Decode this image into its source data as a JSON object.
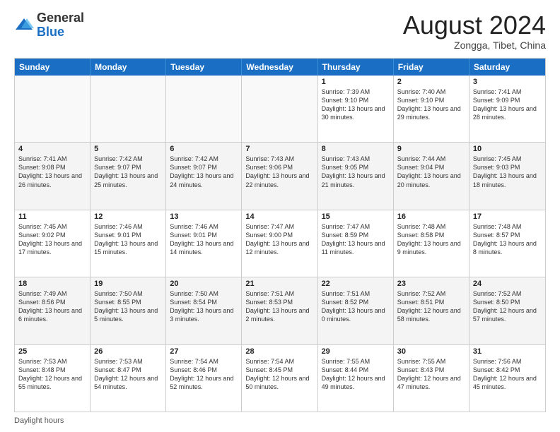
{
  "logo": {
    "general": "General",
    "blue": "Blue"
  },
  "title": {
    "month_year": "August 2024",
    "location": "Zongga, Tibet, China"
  },
  "header_days": [
    "Sunday",
    "Monday",
    "Tuesday",
    "Wednesday",
    "Thursday",
    "Friday",
    "Saturday"
  ],
  "weeks": [
    [
      {
        "day": "",
        "info": ""
      },
      {
        "day": "",
        "info": ""
      },
      {
        "day": "",
        "info": ""
      },
      {
        "day": "",
        "info": ""
      },
      {
        "day": "1",
        "info": "Sunrise: 7:39 AM\nSunset: 9:10 PM\nDaylight: 13 hours and 30 minutes."
      },
      {
        "day": "2",
        "info": "Sunrise: 7:40 AM\nSunset: 9:10 PM\nDaylight: 13 hours and 29 minutes."
      },
      {
        "day": "3",
        "info": "Sunrise: 7:41 AM\nSunset: 9:09 PM\nDaylight: 13 hours and 28 minutes."
      }
    ],
    [
      {
        "day": "4",
        "info": "Sunrise: 7:41 AM\nSunset: 9:08 PM\nDaylight: 13 hours and 26 minutes."
      },
      {
        "day": "5",
        "info": "Sunrise: 7:42 AM\nSunset: 9:07 PM\nDaylight: 13 hours and 25 minutes."
      },
      {
        "day": "6",
        "info": "Sunrise: 7:42 AM\nSunset: 9:07 PM\nDaylight: 13 hours and 24 minutes."
      },
      {
        "day": "7",
        "info": "Sunrise: 7:43 AM\nSunset: 9:06 PM\nDaylight: 13 hours and 22 minutes."
      },
      {
        "day": "8",
        "info": "Sunrise: 7:43 AM\nSunset: 9:05 PM\nDaylight: 13 hours and 21 minutes."
      },
      {
        "day": "9",
        "info": "Sunrise: 7:44 AM\nSunset: 9:04 PM\nDaylight: 13 hours and 20 minutes."
      },
      {
        "day": "10",
        "info": "Sunrise: 7:45 AM\nSunset: 9:03 PM\nDaylight: 13 hours and 18 minutes."
      }
    ],
    [
      {
        "day": "11",
        "info": "Sunrise: 7:45 AM\nSunset: 9:02 PM\nDaylight: 13 hours and 17 minutes."
      },
      {
        "day": "12",
        "info": "Sunrise: 7:46 AM\nSunset: 9:01 PM\nDaylight: 13 hours and 15 minutes."
      },
      {
        "day": "13",
        "info": "Sunrise: 7:46 AM\nSunset: 9:01 PM\nDaylight: 13 hours and 14 minutes."
      },
      {
        "day": "14",
        "info": "Sunrise: 7:47 AM\nSunset: 9:00 PM\nDaylight: 13 hours and 12 minutes."
      },
      {
        "day": "15",
        "info": "Sunrise: 7:47 AM\nSunset: 8:59 PM\nDaylight: 13 hours and 11 minutes."
      },
      {
        "day": "16",
        "info": "Sunrise: 7:48 AM\nSunset: 8:58 PM\nDaylight: 13 hours and 9 minutes."
      },
      {
        "day": "17",
        "info": "Sunrise: 7:48 AM\nSunset: 8:57 PM\nDaylight: 13 hours and 8 minutes."
      }
    ],
    [
      {
        "day": "18",
        "info": "Sunrise: 7:49 AM\nSunset: 8:56 PM\nDaylight: 13 hours and 6 minutes."
      },
      {
        "day": "19",
        "info": "Sunrise: 7:50 AM\nSunset: 8:55 PM\nDaylight: 13 hours and 5 minutes."
      },
      {
        "day": "20",
        "info": "Sunrise: 7:50 AM\nSunset: 8:54 PM\nDaylight: 13 hours and 3 minutes."
      },
      {
        "day": "21",
        "info": "Sunrise: 7:51 AM\nSunset: 8:53 PM\nDaylight: 13 hours and 2 minutes."
      },
      {
        "day": "22",
        "info": "Sunrise: 7:51 AM\nSunset: 8:52 PM\nDaylight: 13 hours and 0 minutes."
      },
      {
        "day": "23",
        "info": "Sunrise: 7:52 AM\nSunset: 8:51 PM\nDaylight: 12 hours and 58 minutes."
      },
      {
        "day": "24",
        "info": "Sunrise: 7:52 AM\nSunset: 8:50 PM\nDaylight: 12 hours and 57 minutes."
      }
    ],
    [
      {
        "day": "25",
        "info": "Sunrise: 7:53 AM\nSunset: 8:48 PM\nDaylight: 12 hours and 55 minutes."
      },
      {
        "day": "26",
        "info": "Sunrise: 7:53 AM\nSunset: 8:47 PM\nDaylight: 12 hours and 54 minutes."
      },
      {
        "day": "27",
        "info": "Sunrise: 7:54 AM\nSunset: 8:46 PM\nDaylight: 12 hours and 52 minutes."
      },
      {
        "day": "28",
        "info": "Sunrise: 7:54 AM\nSunset: 8:45 PM\nDaylight: 12 hours and 50 minutes."
      },
      {
        "day": "29",
        "info": "Sunrise: 7:55 AM\nSunset: 8:44 PM\nDaylight: 12 hours and 49 minutes."
      },
      {
        "day": "30",
        "info": "Sunrise: 7:55 AM\nSunset: 8:43 PM\nDaylight: 12 hours and 47 minutes."
      },
      {
        "day": "31",
        "info": "Sunrise: 7:56 AM\nSunset: 8:42 PM\nDaylight: 12 hours and 45 minutes."
      }
    ]
  ],
  "footer": {
    "daylight_hours": "Daylight hours"
  }
}
